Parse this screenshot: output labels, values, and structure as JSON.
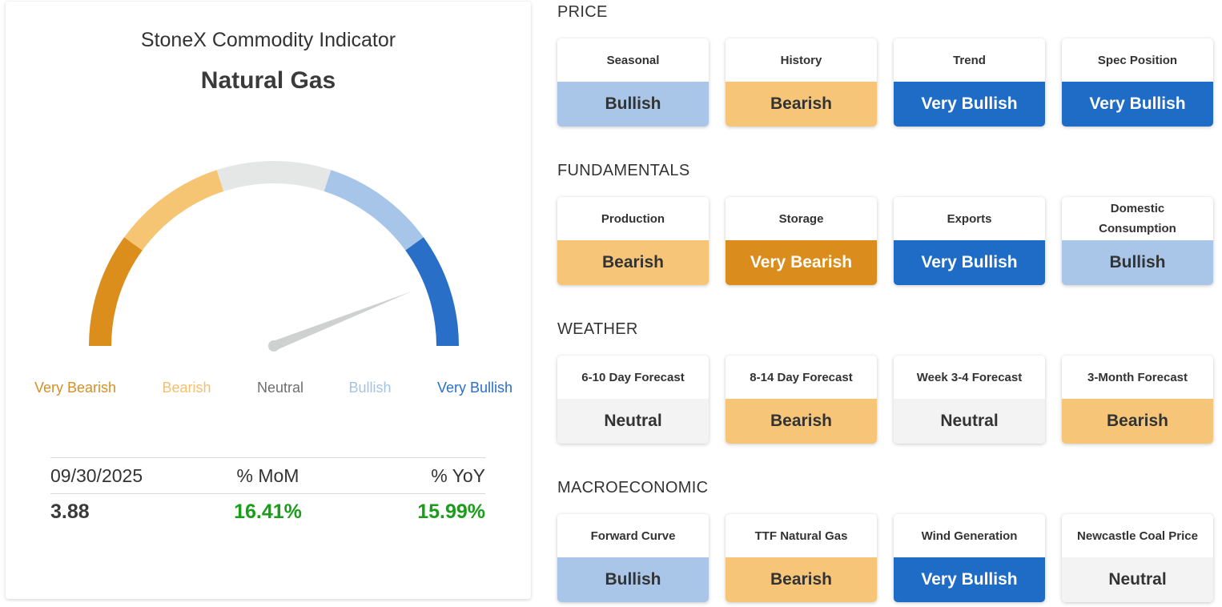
{
  "header": {
    "app_title": "StoneX Commodity Indicator",
    "commodity": "Natural Gas"
  },
  "gauge": {
    "reading": 0.88,
    "segments": [
      {
        "name": "Very Bearish",
        "color": "#db8e1c"
      },
      {
        "name": "Bearish",
        "color": "#f6c574"
      },
      {
        "name": "Neutral",
        "color": "#e5e6e6"
      },
      {
        "name": "Bullish",
        "color": "#a7c5e8"
      },
      {
        "name": "Very Bullish",
        "color": "#2a6fc7"
      }
    ],
    "labels": [
      "Very Bearish",
      "Bearish",
      "Neutral",
      "Bullish",
      "Very Bullish"
    ],
    "label_colors": [
      "#d78f23",
      "#f2c070",
      "#6e6e6e",
      "#a4c3e6",
      "#2a6fc7"
    ],
    "needle_color": "#cfd0d0"
  },
  "stats": {
    "date": "09/30/2025",
    "mom_label": "% MoM",
    "yoy_label": "% YoY",
    "price": "3.88",
    "mom_value": "16.41%",
    "yoy_value": "15.99%"
  },
  "sentiment_styles": {
    "Very Bearish": {
      "bg": "#da8c1c",
      "fg": "#ffffff"
    },
    "Bearish": {
      "bg": "#f7c577",
      "fg": "#333333"
    },
    "Neutral": {
      "bg": "#f3f3f3",
      "fg": "#333333"
    },
    "Bullish": {
      "bg": "#a9c6e8",
      "fg": "#333333"
    },
    "Very Bullish": {
      "bg": "#1f6cc6",
      "fg": "#ffffff"
    }
  },
  "sections": [
    {
      "title": "PRICE",
      "tiles": [
        {
          "label": "Seasonal",
          "value": "Bullish"
        },
        {
          "label": "History",
          "value": "Bearish"
        },
        {
          "label": "Trend",
          "value": "Very Bullish"
        },
        {
          "label": "Spec Position",
          "value": "Very Bullish"
        }
      ]
    },
    {
      "title": "FUNDAMENTALS",
      "tiles": [
        {
          "label": "Production",
          "value": "Bearish"
        },
        {
          "label": "Storage",
          "value": "Very Bearish"
        },
        {
          "label": "Exports",
          "value": "Very Bullish"
        },
        {
          "label": "Domestic Consumption",
          "value": "Bullish"
        }
      ]
    },
    {
      "title": "WEATHER",
      "tiles": [
        {
          "label": "6-10 Day Forecast",
          "value": "Neutral"
        },
        {
          "label": "8-14 Day Forecast",
          "value": "Bearish"
        },
        {
          "label": "Week 3-4 Forecast",
          "value": "Neutral"
        },
        {
          "label": "3-Month Forecast",
          "value": "Bearish"
        }
      ]
    },
    {
      "title": "MACROECONOMIC",
      "tiles": [
        {
          "label": "Forward Curve",
          "value": "Bullish"
        },
        {
          "label": "TTF Natural Gas",
          "value": "Bearish"
        },
        {
          "label": "Wind Generation",
          "value": "Very Bullish"
        },
        {
          "label": "Newcastle Coal Price",
          "value": "Neutral"
        }
      ]
    }
  ]
}
